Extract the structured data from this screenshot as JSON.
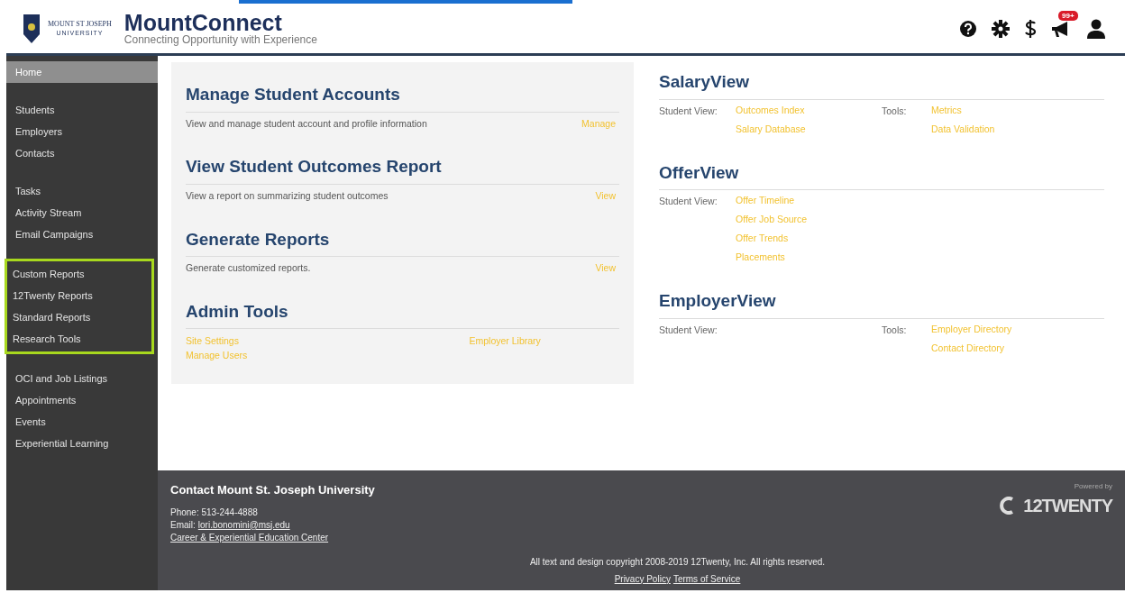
{
  "header": {
    "logo_line_1": "MOUNT ST JOSEPH",
    "logo_line_2": "UNIVERSITY",
    "title": "MountConnect",
    "tagline": "Connecting Opportunity with Experience",
    "icons": [
      {
        "kind": "help"
      },
      {
        "kind": "settings"
      },
      {
        "kind": "dollar"
      },
      {
        "kind": "megaphone",
        "badge": "99+"
      },
      {
        "kind": "user"
      }
    ]
  },
  "sidebar": {
    "groups": [
      {
        "highlighted": false,
        "items": [
          {
            "label": "Home",
            "selected": true
          }
        ]
      },
      {
        "highlighted": false,
        "items": [
          {
            "label": "Students",
            "selected": false
          },
          {
            "label": "Employers",
            "selected": false
          },
          {
            "label": "Contacts",
            "selected": false
          }
        ]
      },
      {
        "highlighted": false,
        "items": [
          {
            "label": "Tasks",
            "selected": false
          },
          {
            "label": "Activity Stream",
            "selected": false
          },
          {
            "label": "Email Campaigns",
            "selected": false
          }
        ]
      },
      {
        "highlighted": true,
        "items": [
          {
            "label": "Custom Reports",
            "selected": false
          },
          {
            "label": "12Twenty Reports",
            "selected": false
          },
          {
            "label": "Standard Reports",
            "selected": false
          },
          {
            "label": "Research Tools",
            "selected": false
          }
        ]
      },
      {
        "highlighted": false,
        "items": [
          {
            "label": "OCI and Job Listings",
            "selected": false
          },
          {
            "label": "Appointments",
            "selected": false
          },
          {
            "label": "Events",
            "selected": false
          },
          {
            "label": "Experiential Learning",
            "selected": false
          }
        ]
      }
    ]
  },
  "left_panel": {
    "sections": [
      {
        "title": "Manage Student Accounts",
        "description": "View and manage student account and profile information",
        "action": "Manage"
      },
      {
        "title": "View Student Outcomes Report",
        "description": "View a report on summarizing student outcomes",
        "action": "View"
      },
      {
        "title": "Generate Reports",
        "description": "Generate customized reports.",
        "action": "View"
      },
      {
        "title": "Admin Tools",
        "links_left": [
          "Site Settings",
          "Manage Users"
        ],
        "links_right": [
          "Employer Library"
        ]
      }
    ]
  },
  "right_panel": {
    "sections": [
      {
        "title": "SalaryView",
        "student_view_label": "Student View:",
        "student_links": [
          "Outcomes Index",
          "Salary Database"
        ],
        "tools_label": "Tools:",
        "tool_links": [
          "Metrics",
          "Data Validation"
        ]
      },
      {
        "title": "OfferView",
        "student_view_label": "Student View:",
        "student_links": [
          "Offer Timeline",
          "Offer Job Source",
          "Offer Trends",
          "Placements"
        ]
      },
      {
        "title": "EmployerView",
        "student_view_label": "Student View:",
        "tools_label": "Tools:",
        "tool_links": [
          "Employer Directory",
          "Contact Directory"
        ]
      }
    ]
  },
  "footer": {
    "heading": "Contact Mount St. Joseph University",
    "phone": "Phone: 513-244-4888",
    "email_label": "Email:",
    "email": "lori.bonomini@msj.edu",
    "office_link": "Career & Experiential Education Center",
    "copyright": "All text and design copyright 2008-2019 12Twenty, Inc. All rights reserved.",
    "privacy_link": "Privacy Policy",
    "terms_link": "Terms of Service",
    "powered_by": "Powered by",
    "brand": "12TWENTY"
  }
}
